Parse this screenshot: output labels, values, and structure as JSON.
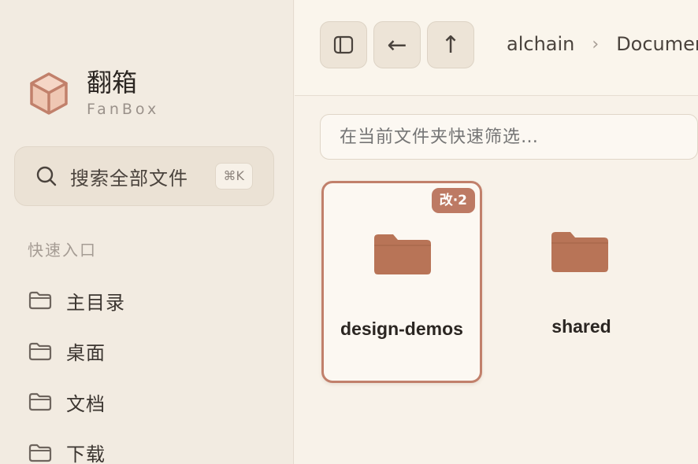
{
  "brand": {
    "name": "翻箱",
    "subtitle": "FanBox"
  },
  "sidebar": {
    "search": {
      "label": "搜索全部文件",
      "shortcut": "⌘K",
      "icon": "search-icon"
    },
    "section_label": "快速入口",
    "items": [
      {
        "label": "主目录",
        "icon": "folder-icon"
      },
      {
        "label": "桌面",
        "icon": "folder-icon"
      },
      {
        "label": "文档",
        "icon": "folder-icon"
      },
      {
        "label": "下载",
        "icon": "folder-icon"
      }
    ]
  },
  "toolbar": {
    "toggle_icon": "sidebar-toggle-icon",
    "back_label": "←",
    "up_label": "↑",
    "breadcrumb": [
      "alchain",
      "Documents"
    ],
    "separator": "›"
  },
  "filter": {
    "placeholder": "在当前文件夹快速筛选…"
  },
  "files": [
    {
      "name": "design-demos",
      "badge": "改·2",
      "selected": true,
      "icon": "folder-icon"
    },
    {
      "name": "shared",
      "badge": "",
      "selected": false,
      "icon": "folder-icon"
    }
  ],
  "colors": {
    "accent": "#bd7a64",
    "folder": "#b87457",
    "sidebar_bg": "#f2ebe1",
    "main_bg": "#f8f2e9"
  }
}
